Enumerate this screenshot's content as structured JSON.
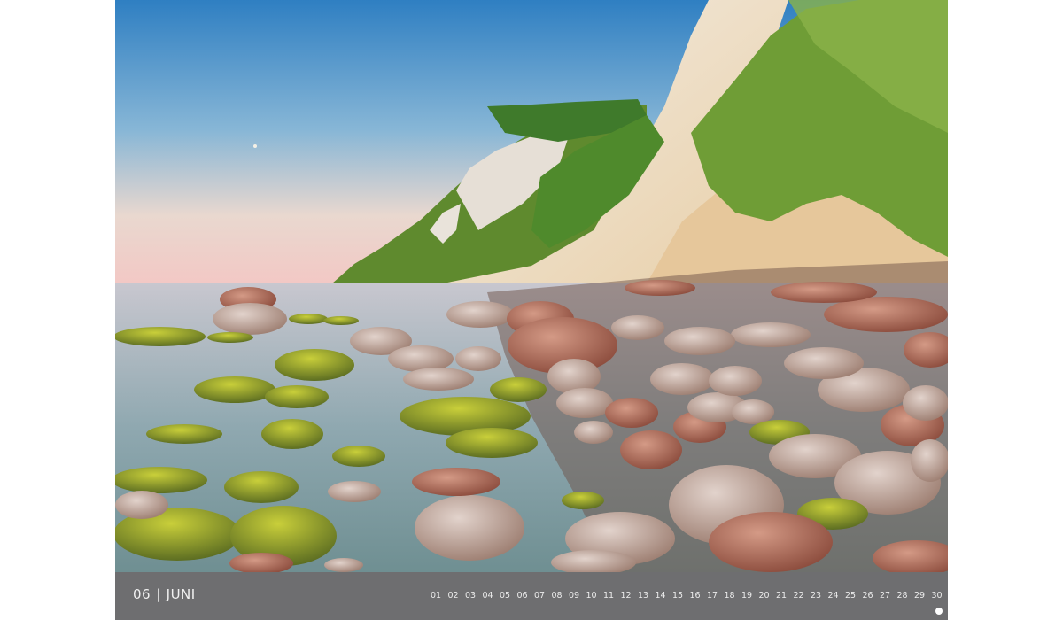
{
  "calendar": {
    "month_number": "06",
    "separator": "|",
    "month_name": "JUNI",
    "days": [
      "01",
      "02",
      "03",
      "04",
      "05",
      "06",
      "07",
      "08",
      "09",
      "10",
      "11",
      "12",
      "13",
      "14",
      "15",
      "16",
      "17",
      "18",
      "19",
      "20",
      "21",
      "22",
      "23",
      "24",
      "25",
      "26",
      "27",
      "28",
      "29",
      "30"
    ]
  },
  "photo": {
    "subject": "chalk-cliffs-coast",
    "colors": {
      "sky_top": "#2f7fc2",
      "sky_horizon": "#f3c7c4",
      "sea": "#8fa8b0",
      "cliff": "#efe2cc",
      "forest": "#6a9a3a",
      "moss": "#a8b830",
      "stone": "#b8a298"
    }
  },
  "footer": {
    "strip_color": "#6e6e70"
  }
}
